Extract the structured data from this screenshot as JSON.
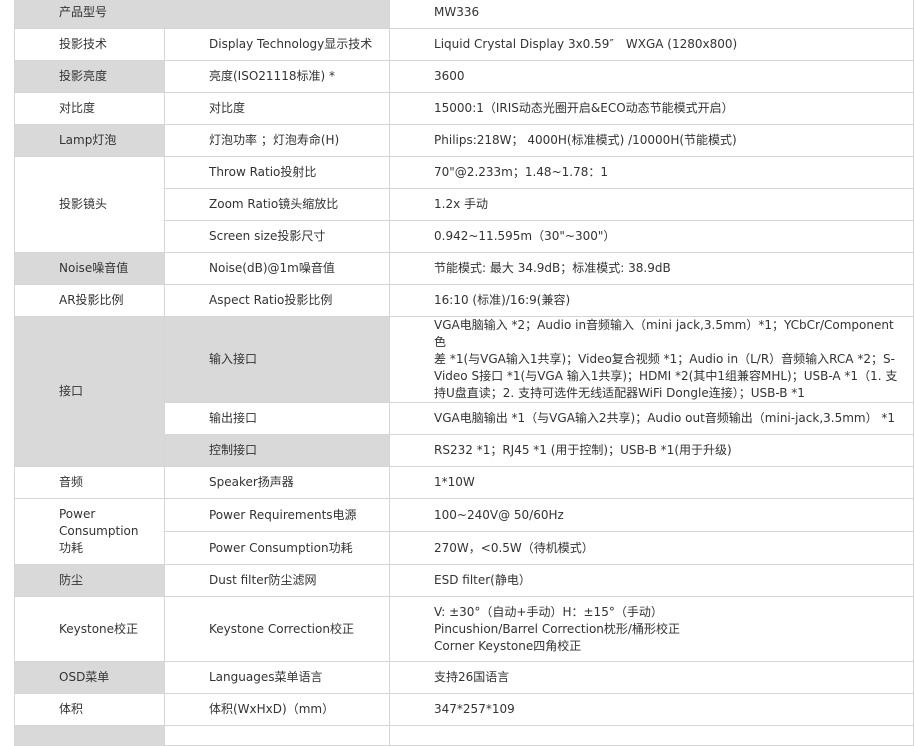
{
  "header": {
    "label": "产品型号",
    "value": "MW336"
  },
  "rows": [
    {
      "cat": "投影技术",
      "sub": "Display Technology显示技术",
      "val": "Liquid Crystal Display 3x0.59″　WXGA (1280x800)"
    },
    {
      "cat": "投影亮度",
      "sub": "亮度(ISO21118标准) *",
      "val": "3600"
    },
    {
      "cat": "对比度",
      "sub": "对比度",
      "val": "15000:1（IRIS动态光圈开启&ECO动态节能模式开启）"
    },
    {
      "cat": "Lamp灯泡",
      "sub": "灯泡功率 ；灯泡寿命(H)",
      "val": "Philips:218W； 4000H(标准模式) /10000H(节能模式)"
    },
    {
      "cat": "投影镜头",
      "subs": [
        {
          "sub": "Throw Ratio投射比",
          "val": "70\"@2.233m；1.48~1.78：1"
        },
        {
          "sub": "Zoom Ratio镜头缩放比",
          "val": "1.2x 手动"
        },
        {
          "sub": "Screen size投影尺寸",
          "val": "0.942~11.595m（30\"~300\"）"
        }
      ]
    },
    {
      "cat": "Noise噪音值",
      "sub": "Noise(dB)@1m噪音值",
      "val": " 节能模式: 最大 34.9dB；标准模式: 38.9dB"
    },
    {
      "cat": "AR投影比例",
      "sub": "Aspect Ratio投影比例",
      "val": "16:10 (标准)/16:9(兼容)"
    },
    {
      "cat": "接口",
      "subs": [
        {
          "sub": "输入接口",
          "val_lines": [
            "VGA电脑输入 *2；Audio in音频输入（mini jack,3.5mm）*1；YCbCr/Component色",
            "差 *1(与VGA输入1共享)；Video复合视频 *1；Audio in（L/R）音频输入RCA *2；S-",
            "Video S接口 *1(与VGA 输入1共享)；HDMI *2(其中1组兼容MHL)；USB-A *1（1. 支",
            "持U盘直读；2. 支持可选件无线适配器WiFi Dongle连接）；USB-B *1"
          ]
        },
        {
          "sub": "输出接口",
          "val": "VGA电脑输出 *1（与VGA输入2共享)；Audio out音频输出（mini-jack,3.5mm） *1"
        },
        {
          "sub": "控制接口",
          "val": "RS232 *1；RJ45 *1 (用于控制)；USB-B *1(用于升级)"
        }
      ]
    },
    {
      "cat": "音频",
      "sub": "Speaker扬声器",
      "val": "1*10W"
    },
    {
      "cat_lines": [
        "Power",
        "Consumption",
        "功耗"
      ],
      "subs": [
        {
          "sub": "Power Requirements电源",
          "val": "100~240V@ 50/60Hz"
        },
        {
          "sub": "Power Consumption功耗",
          "val": "270W，<0.5W（待机模式）"
        }
      ]
    },
    {
      "cat": "防尘",
      "sub": "Dust filter防尘滤网",
      "val": "ESD filter(静电）"
    },
    {
      "cat": "Keystone校正",
      "sub": "Keystone Correction校正",
      "val_lines": [
        "V: ±30°（自动+手动）H：±15°（手动）",
        "Pincushion/Barrel Correction枕形/桶形校正",
        "Corner Keystone四角校正"
      ]
    },
    {
      "cat": "OSD菜单",
      "sub": "Languages菜单语言",
      "val": "支持26国语言"
    },
    {
      "cat": "体积",
      "sub": "体积(WxHxD)（mm）",
      "val": "347*257*109"
    }
  ]
}
